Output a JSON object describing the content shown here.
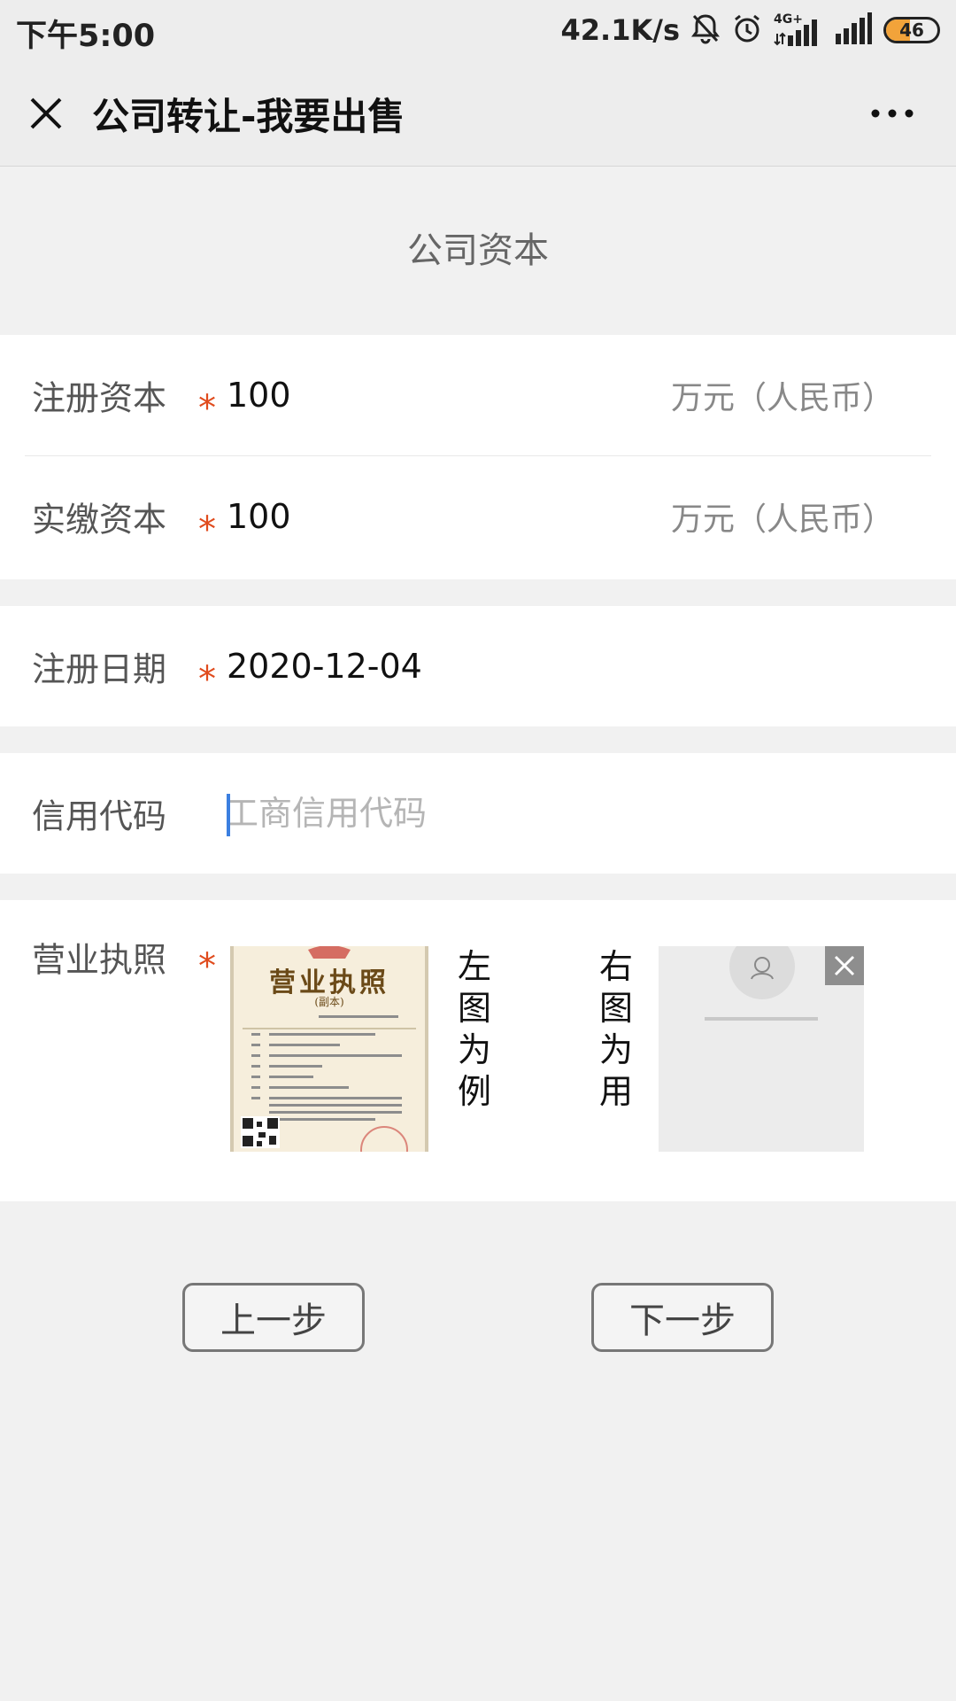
{
  "status_bar": {
    "time": "下午5:00",
    "net_speed": "42.1K/s",
    "network_label": "4G+",
    "battery_level": 46,
    "battery_text": "46"
  },
  "nav": {
    "title": "公司转让-我要出售"
  },
  "section": {
    "title": "公司资本"
  },
  "fields": {
    "registered_capital": {
      "label": "注册资本",
      "required_mark": "*",
      "value": "100",
      "unit": "万元（人民币）"
    },
    "paid_in_capital": {
      "label": "实缴资本",
      "required_mark": "*",
      "value": "100",
      "unit": "万元（人民币）"
    },
    "registration_date": {
      "label": "注册日期",
      "required_mark": "*",
      "value": "2020-12-04"
    },
    "credit_code": {
      "label": "信用代码",
      "value": "",
      "placeholder": "工商信用代码"
    },
    "business_license": {
      "label": "营业执照",
      "required_mark": "*",
      "example_title": "营业执照",
      "example_subtitle": "(副本)",
      "left_note": "左图为例",
      "right_note": "右图为用"
    }
  },
  "buttons": {
    "prev": "上一步",
    "next": "下一步"
  },
  "colors": {
    "required": "#e04b1d",
    "caret": "#3b7fe0",
    "battery": "#f2a33a"
  }
}
